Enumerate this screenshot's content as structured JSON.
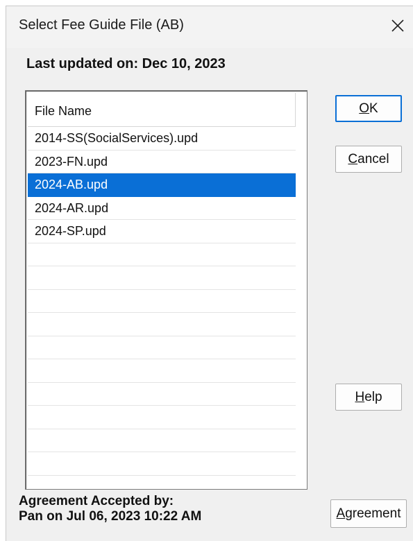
{
  "window": {
    "title": "Select Fee Guide File (AB)"
  },
  "last_updated": "Last updated on: Dec 10, 2023",
  "list": {
    "header": "File Name",
    "rows": [
      "2014-SS(SocialServices).upd",
      "2023-FN.upd",
      "2024-AB.upd",
      "2024-AR.upd",
      "2024-SP.upd",
      "",
      "",
      "",
      "",
      "",
      "",
      "",
      "",
      "",
      "",
      ""
    ],
    "selected_index": 2
  },
  "buttons": {
    "ok": {
      "mnemonic": "O",
      "rest": "K"
    },
    "cancel": {
      "mnemonic": "C",
      "rest": "ancel"
    },
    "help": {
      "mnemonic": "H",
      "rest": "elp"
    },
    "agreement": {
      "mnemonic": "A",
      "rest": "greement"
    }
  },
  "agreement": {
    "line1": "Agreement Accepted by:",
    "line2": "Pan on Jul 06, 2023 10:22 AM"
  },
  "colors": {
    "selection": "#0a6fd6",
    "default_button_border": "#0a6fd6"
  },
  "icons": {
    "close": "close-icon"
  }
}
